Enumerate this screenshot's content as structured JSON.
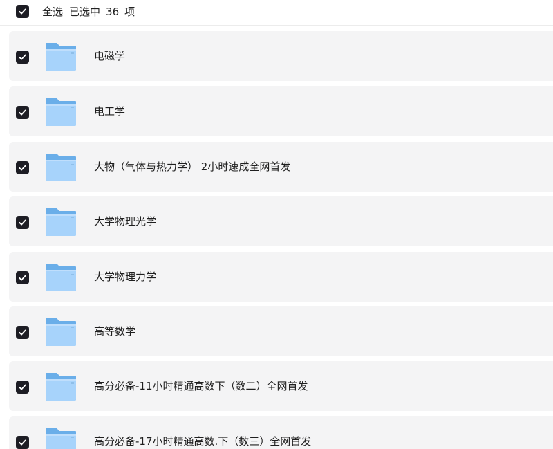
{
  "header": {
    "select_all_label": "全选",
    "selected_prefix": "已选中",
    "selected_count": "36",
    "selected_suffix": "项"
  },
  "folder_icon": "folder-icon",
  "check_icon": "check-icon",
  "colors": {
    "checkbox_fill": "#1d1d24",
    "row_background": "#f4f4f5",
    "folder_back": "#6aaee9",
    "folder_front": "#a7d3fb"
  },
  "files": [
    {
      "name": "电磁学"
    },
    {
      "name": "电工学"
    },
    {
      "name": "大物（气体与热力学） 2小时速成全网首发"
    },
    {
      "name": "大学物理光学"
    },
    {
      "name": "大学物理力学"
    },
    {
      "name": "高等数学"
    },
    {
      "name": "高分必备-11小时精通高数下（数二）全网首发"
    },
    {
      "name": "高分必备-17小时精通高数.下（数三）全网首发"
    }
  ]
}
